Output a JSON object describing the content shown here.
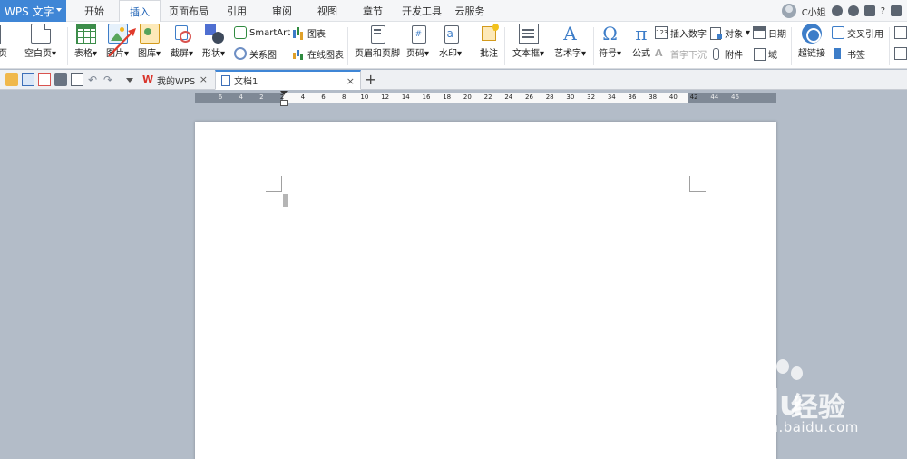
{
  "app": {
    "name": "WPS 文字"
  },
  "menu_tabs": [
    "开始",
    "插入",
    "页面布局",
    "引用",
    "审阅",
    "视图",
    "章节",
    "开发工具",
    "云服务"
  ],
  "active_menu_tab": "插入",
  "user": {
    "name": "C小姐"
  },
  "help_label": "?",
  "ribbon": {
    "page_label": "页",
    "blank_page": "空白页",
    "table": "表格",
    "picture": "图片",
    "gallery": "图库",
    "screenshot": "截屏",
    "shapes": "形状",
    "smartart": "SmartArt",
    "chart": "图表",
    "relation": "关系图",
    "online_chart": "在线图表",
    "header_footer": "页眉和页脚",
    "page_number": "页码",
    "watermark": "水印",
    "comment": "批注",
    "textbox": "文本框",
    "wordart": "艺术字",
    "symbol": "符号",
    "equation": "公式",
    "insert_number": "插入数字",
    "object": "对象",
    "date": "日期",
    "dropcap": "首字下沉",
    "attachment": "附件",
    "field": "域",
    "hyperlink": "超链接",
    "crossref": "交叉引用",
    "bookmark": "书签",
    "dropdown_glyph": "▾"
  },
  "doc_tabs": [
    {
      "label": "我的WPS",
      "close": "×"
    },
    {
      "label": "文档1",
      "close": "×"
    }
  ],
  "add_tab": "+",
  "ruler_ticks": [
    "6",
    "4",
    "2",
    "2",
    "4",
    "6",
    "8",
    "10",
    "12",
    "14",
    "16",
    "18",
    "20",
    "22",
    "24",
    "26",
    "28",
    "30",
    "32",
    "34",
    "36",
    "38",
    "40",
    "42",
    "44",
    "46"
  ],
  "watermark": {
    "brand": "Baidu",
    "cn": "经验",
    "url": "jingyan.baidu.com"
  },
  "colors": {
    "accent": "#3f86d6",
    "workspace": "#b3bcc8",
    "annotation_arrow": "#e03a2b"
  }
}
